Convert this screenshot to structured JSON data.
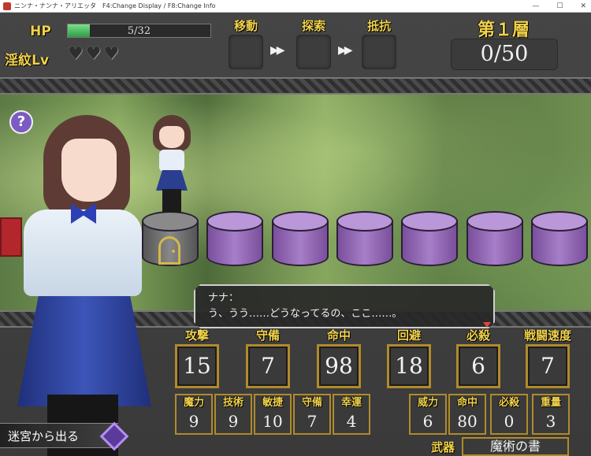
{
  "window": {
    "title": "ニンナ・ナンナ・アリエッタ　F4:Change Display / F8:Change Info",
    "controls": [
      "—",
      "☐",
      "✕"
    ]
  },
  "hud": {
    "hp_label": "HP",
    "hp_text": "5/32",
    "hp_fraction": 0.156,
    "lewd_label": "淫紋Lv",
    "hearts": [
      "♥",
      "♥",
      "♥"
    ],
    "actions": [
      {
        "label": "移動"
      },
      {
        "label": "探索"
      },
      {
        "label": "抵抗"
      }
    ],
    "arrow": "▶▶",
    "floor_label": "第１層",
    "progress": "0/50"
  },
  "scene": {
    "help_icon": "?",
    "current_tile_icon": "door-icon"
  },
  "dialog": {
    "speaker": "ナナ：",
    "text": "う、うう……どうなってるの、ここ……。"
  },
  "stats": {
    "main": [
      {
        "label": "攻撃",
        "value": "15"
      },
      {
        "label": "守備",
        "value": "7"
      },
      {
        "label": "命中",
        "value": "98"
      },
      {
        "label": "回避",
        "value": "18"
      },
      {
        "label": "必殺",
        "value": "6"
      },
      {
        "label": "戦闘速度",
        "value": "7"
      }
    ],
    "sub_left": [
      {
        "label": "魔力",
        "value": "9"
      },
      {
        "label": "技術",
        "value": "9"
      },
      {
        "label": "敏捷",
        "value": "10"
      },
      {
        "label": "守備",
        "value": "7"
      },
      {
        "label": "幸運",
        "value": "4"
      }
    ],
    "sub_right": [
      {
        "label": "威力",
        "value": "6"
      },
      {
        "label": "命中",
        "value": "80"
      },
      {
        "label": "必殺",
        "value": "0"
      },
      {
        "label": "重量",
        "value": "3"
      }
    ],
    "weapon_label": "武器",
    "weapon_name": "魔術の書"
  },
  "exit_button": "迷宮から出る",
  "colors": {
    "gold": "#f3d34b",
    "frame": "#b08a2c",
    "tile": "#a77ec8"
  }
}
